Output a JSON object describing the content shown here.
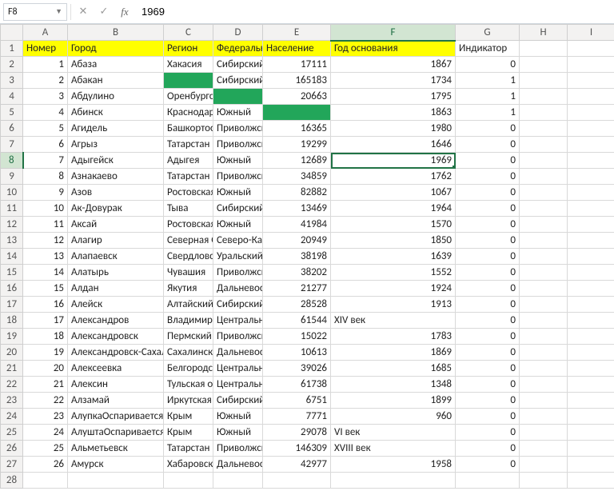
{
  "namebox": {
    "cell_ref": "F8"
  },
  "formula_bar": {
    "fx_label": "fx",
    "value": "1969"
  },
  "columns": [
    "A",
    "B",
    "C",
    "D",
    "E",
    "F",
    "G",
    "H",
    "I"
  ],
  "active_col_index": 5,
  "headers": {
    "A": "Номер",
    "B": "Город",
    "C": "Регион",
    "D": "Федеральный округ",
    "E": "Население",
    "F": "Год основания",
    "G": "Индикатор"
  },
  "green_cells": [
    "C3",
    "D4",
    "E5"
  ],
  "selected_cell_row": 8,
  "rows": [
    {
      "n": 1,
      "city": "Абаза",
      "region": "Хакасия",
      "district": "Сибирский",
      "pop": 17111,
      "year": "1867",
      "ind": 0
    },
    {
      "n": 2,
      "city": "Абакан",
      "region": "",
      "district": "Сибирский",
      "pop": 165183,
      "year": "1734",
      "ind": 1
    },
    {
      "n": 3,
      "city": "Абдулино",
      "region": "Оренбургская область",
      "district": "",
      "pop": 20663,
      "year": "1795",
      "ind": 1
    },
    {
      "n": 4,
      "city": "Абинск",
      "region": "Краснодарский край",
      "district": "Южный",
      "pop": "",
      "year": "1863",
      "ind": 1
    },
    {
      "n": 5,
      "city": "Агидель",
      "region": "Башкортостан",
      "district": "Приволжский",
      "pop": 16365,
      "year": "1980",
      "ind": 0
    },
    {
      "n": 6,
      "city": "Агрыз",
      "region": "Татарстан",
      "district": "Приволжский",
      "pop": 19299,
      "year": "1646",
      "ind": 0
    },
    {
      "n": 7,
      "city": "Адыгейск",
      "region": "Адыгея",
      "district": "Южный",
      "pop": 12689,
      "year": "1969",
      "ind": 0
    },
    {
      "n": 8,
      "city": "Азнакаево",
      "region": "Татарстан",
      "district": "Приволжский",
      "pop": 34859,
      "year": "1762",
      "ind": 0
    },
    {
      "n": 9,
      "city": "Азов",
      "region": "Ростовская область",
      "district": "Южный",
      "pop": 82882,
      "year": "1067",
      "ind": 0
    },
    {
      "n": 10,
      "city": "Ак-Довурак",
      "region": "Тыва",
      "district": "Сибирский",
      "pop": 13469,
      "year": "1964",
      "ind": 0
    },
    {
      "n": 11,
      "city": "Аксай",
      "region": "Ростовская область",
      "district": "Южный",
      "pop": 41984,
      "year": "1570",
      "ind": 0
    },
    {
      "n": 12,
      "city": "Алагир",
      "region": "Северная Осетия",
      "district": "Северо-Кавказский",
      "pop": 20949,
      "year": "1850",
      "ind": 0
    },
    {
      "n": 13,
      "city": "Алапаевск",
      "region": "Свердловская область",
      "district": "Уральский",
      "pop": 38198,
      "year": "1639",
      "ind": 0
    },
    {
      "n": 14,
      "city": "Алатырь",
      "region": "Чувашия",
      "district": "Приволжский",
      "pop": 38202,
      "year": "1552",
      "ind": 0
    },
    {
      "n": 15,
      "city": "Алдан",
      "region": "Якутия",
      "district": "Дальневосточный",
      "pop": 21277,
      "year": "1924",
      "ind": 0
    },
    {
      "n": 16,
      "city": "Алейск",
      "region": "Алтайский край",
      "district": "Сибирский",
      "pop": 28528,
      "year": "1913",
      "ind": 0
    },
    {
      "n": 17,
      "city": "Александров",
      "region": "Владимирская область",
      "district": "Центральный",
      "pop": 61544,
      "year": "XIV век",
      "ind": 0
    },
    {
      "n": 18,
      "city": "Александровск",
      "region": "Пермский край",
      "district": "Приволжский",
      "pop": 15022,
      "year": "1783",
      "ind": 0
    },
    {
      "n": 19,
      "city": "Александровск-Сахалинский",
      "region": "Сахалинская область",
      "district": "Дальневосточный",
      "pop": 10613,
      "year": "1869",
      "ind": 0
    },
    {
      "n": 20,
      "city": "Алексеевка",
      "region": "Белгородская область",
      "district": "Центральный",
      "pop": 39026,
      "year": "1685",
      "ind": 0
    },
    {
      "n": 21,
      "city": "Алексин",
      "region": "Тульская область",
      "district": "Центральный",
      "pop": 61738,
      "year": "1348",
      "ind": 0
    },
    {
      "n": 22,
      "city": "Алзамай",
      "region": "Иркутская область",
      "district": "Сибирский",
      "pop": 6751,
      "year": "1899",
      "ind": 0
    },
    {
      "n": 23,
      "city": "АлупкаОспаривается",
      "region": "Крым",
      "district": "Южный",
      "pop": 7771,
      "year": "960",
      "ind": 0
    },
    {
      "n": 24,
      "city": "АлуштаОспаривается",
      "region": "Крым",
      "district": "Южный",
      "pop": 29078,
      "year": "VI век",
      "ind": 0
    },
    {
      "n": 25,
      "city": "Альметьевск",
      "region": "Татарстан",
      "district": "Приволжский",
      "pop": 146309,
      "year": "XVIII век",
      "ind": 0
    },
    {
      "n": 26,
      "city": "Амурск",
      "region": "Хабаровский край",
      "district": "Дальневосточный",
      "pop": 42977,
      "year": "1958",
      "ind": 0
    }
  ]
}
